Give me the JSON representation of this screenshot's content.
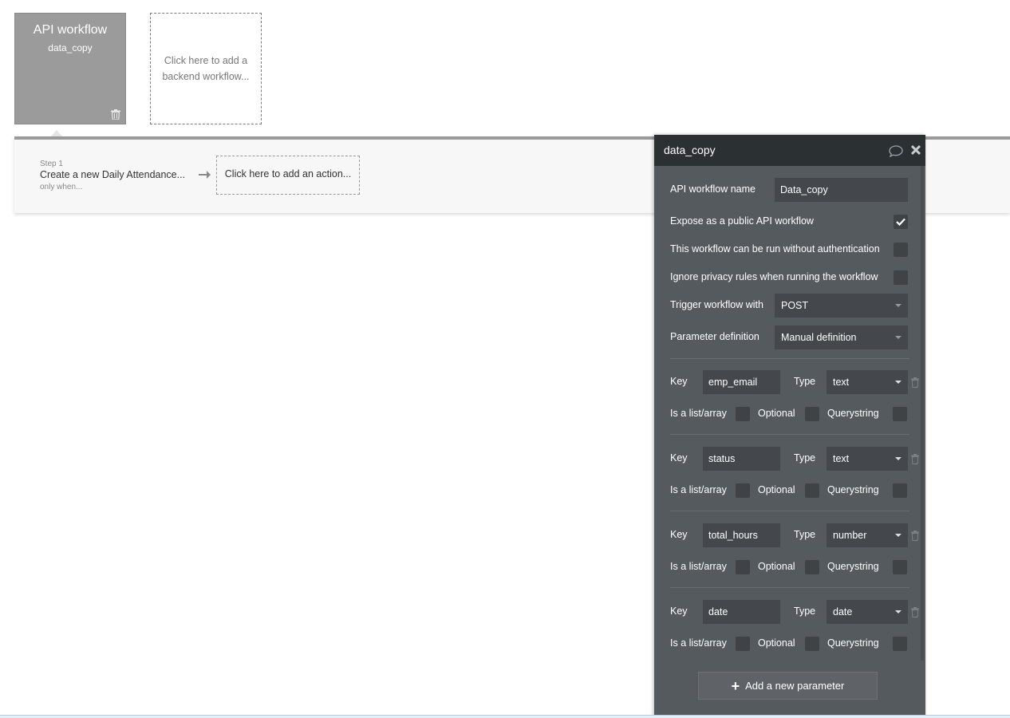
{
  "workflow_card": {
    "title": "API workflow",
    "subtitle": "data_copy"
  },
  "add_backend_workflow": "Click here to add a backend workflow...",
  "steps": [
    {
      "number": "Step 1",
      "action": "Create a new Daily Attendance...",
      "condition": "only when..."
    }
  ],
  "add_action": "Click here to add an action...",
  "panel": {
    "title": "data_copy",
    "name_label": "API workflow name",
    "name_value": "Data_copy",
    "expose_label": "Expose as a public API workflow",
    "expose_checked": true,
    "no_auth_label": "This workflow can be run without authentication",
    "no_auth_checked": false,
    "ignore_privacy_label": "Ignore privacy rules when running the workflow",
    "ignore_privacy_checked": false,
    "trigger_label": "Trigger workflow with",
    "trigger_value": "POST",
    "param_def_label": "Parameter definition",
    "param_def_value": "Manual definition",
    "key_label": "Key",
    "type_label": "Type",
    "list_label": "Is a list/array",
    "optional_label": "Optional",
    "querystring_label": "Querystring",
    "parameters": [
      {
        "key": "emp_email",
        "type": "text"
      },
      {
        "key": "status",
        "type": "text"
      },
      {
        "key": "total_hours",
        "type": "number"
      },
      {
        "key": "date",
        "type": "date"
      }
    ],
    "add_parameter": "Add a new parameter"
  }
}
